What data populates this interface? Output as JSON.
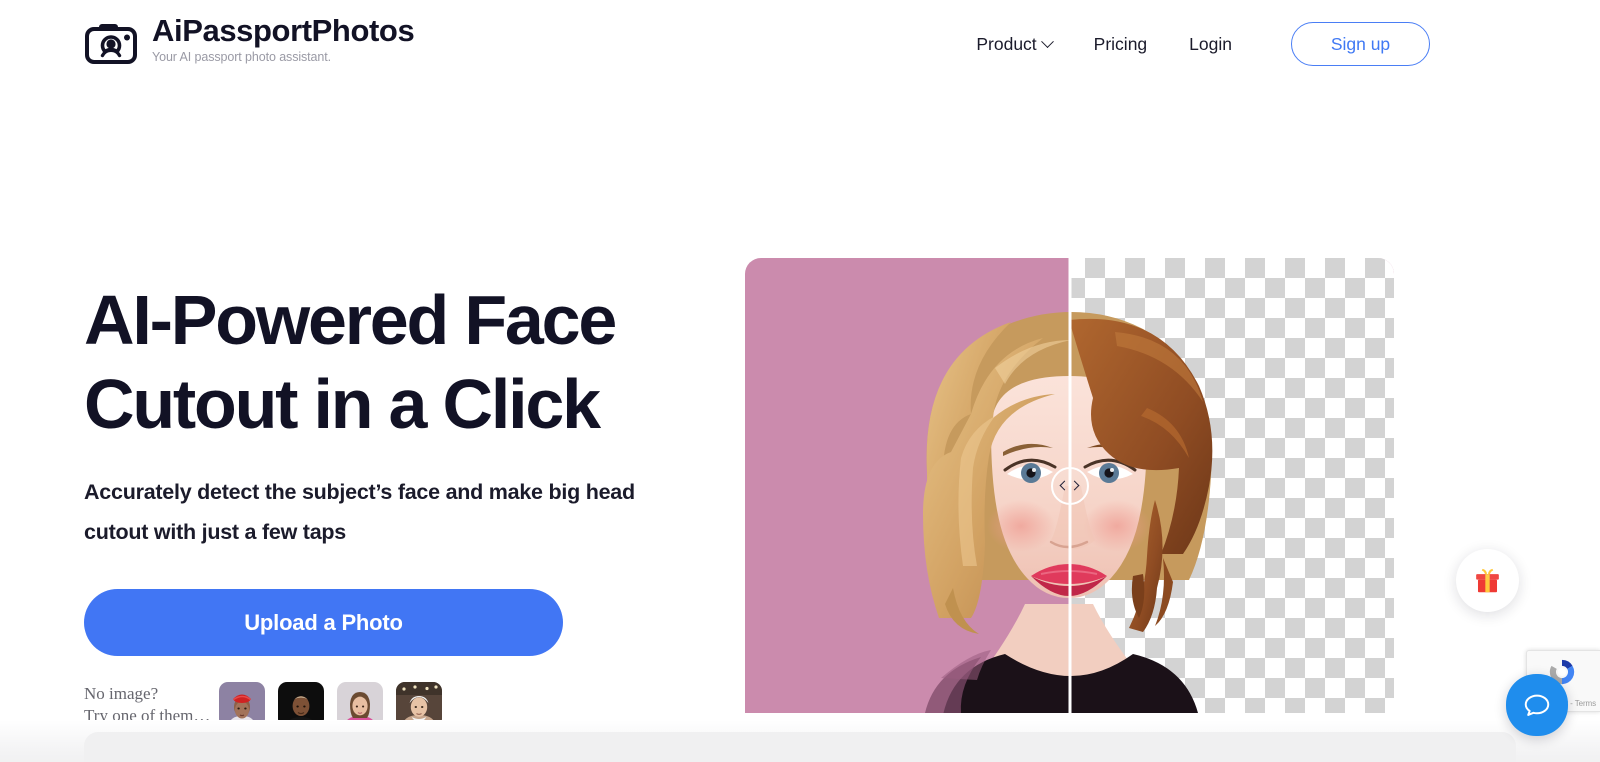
{
  "header": {
    "brand_name": "AiPassportPhotos",
    "brand_tagline": "Your AI passport photo assistant.",
    "logo_icon": "camera-portrait-icon",
    "nav": [
      {
        "label": "Product",
        "has_dropdown": true
      },
      {
        "label": "Pricing",
        "has_dropdown": false
      },
      {
        "label": "Login",
        "has_dropdown": false
      }
    ],
    "signup_label": "Sign up"
  },
  "hero": {
    "headline": "AI-Powered Face\nCutout in a Click",
    "subheadline": "Accurately detect the subject’s face and make big head cutout with just a few taps",
    "upload_button_label": "Upload a Photo",
    "samples_label": "No image?\nTry one of them…",
    "samples": [
      {
        "name": "sample-woman-red-headwrap",
        "bg": "#8d82a3"
      },
      {
        "name": "sample-man-dark-background",
        "bg": "#0d0d0d"
      },
      {
        "name": "sample-woman-pink-top",
        "bg": "#d8d3d8"
      },
      {
        "name": "sample-senior-woman-outdoors",
        "bg": "#6c5a4b"
      }
    ],
    "comparison": {
      "before_label": "original photo with pink background",
      "after_label": "cutout with transparent background",
      "slider_position_percent": 50,
      "handle_icons": [
        "chevron-left-icon",
        "chevron-right-icon"
      ],
      "before_background_color": "#cb8bad",
      "checkerboard_color": "#d3d3d3"
    }
  },
  "widgets": {
    "gift_icon": "gift-icon",
    "recaptcha_text": "Privacy - Terms",
    "recaptcha_icon": "recaptcha-icon",
    "chat_icon": "chat-bubble-icon"
  },
  "colors": {
    "accent_blue": "#4176f4",
    "link_blue": "#4079f4",
    "text_dark": "#121225",
    "text_muted": "#66666e",
    "hero_pink": "#cb8bad",
    "chat_blue": "#1f8ded"
  }
}
